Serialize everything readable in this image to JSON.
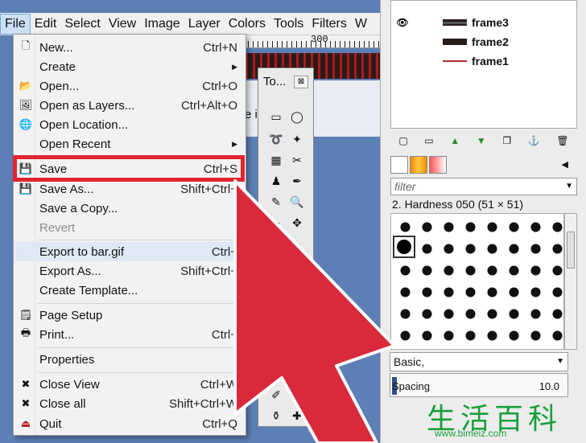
{
  "menubar": {
    "items": [
      {
        "label": "File",
        "active": true
      },
      {
        "label": "Edit"
      },
      {
        "label": "Select"
      },
      {
        "label": "View"
      },
      {
        "label": "Image"
      },
      {
        "label": "Layer"
      },
      {
        "label": "Colors"
      },
      {
        "label": "Tools"
      },
      {
        "label": "Filters"
      },
      {
        "label": "W"
      }
    ]
  },
  "canvas": {
    "ruler_mark": "300",
    "partial_text": "e i",
    "partial_text2": "n"
  },
  "file_menu": {
    "items": [
      {
        "label": "New...",
        "shortcut": "Ctrl+N",
        "icon": "new-file-icon"
      },
      {
        "label": "Create",
        "shortcut": "",
        "submenu": true
      },
      {
        "label": "Open...",
        "shortcut": "Ctrl+O",
        "icon": "open-folder-icon"
      },
      {
        "label": "Open as Layers...",
        "shortcut": "Ctrl+Alt+O",
        "icon": "open-layers-icon"
      },
      {
        "label": "Open Location...",
        "shortcut": "",
        "icon": "globe-icon"
      },
      {
        "label": "Open Recent",
        "shortcut": "",
        "submenu": true
      },
      {
        "label": "Save",
        "shortcut": "Ctrl+S",
        "icon": "save-icon",
        "highlighted": true
      },
      {
        "label": "Save As...",
        "shortcut": "Shift+Ctrl+",
        "icon": "save-as-icon"
      },
      {
        "label": "Save a Copy...",
        "shortcut": ""
      },
      {
        "label": "Revert",
        "shortcut": "",
        "disabled": true
      },
      {
        "label": "Export to bar.gif",
        "shortcut": "Ctrl+"
      },
      {
        "label": "Export As...",
        "shortcut": "Shift+Ctrl+"
      },
      {
        "label": "Create Template...",
        "shortcut": ""
      },
      {
        "label": "Page Setup",
        "shortcut": "",
        "icon": "page-setup-icon"
      },
      {
        "label": "Print...",
        "shortcut": "Ctrl+",
        "icon": "print-icon"
      },
      {
        "label": "Properties",
        "shortcut": ""
      },
      {
        "label": "Close View",
        "shortcut": "Ctrl+W",
        "icon": "close-icon"
      },
      {
        "label": "Close all",
        "shortcut": "Shift+Ctrl+W",
        "icon": "close-icon"
      },
      {
        "label": "Quit",
        "shortcut": "Ctrl+Q",
        "icon": "quit-icon"
      }
    ]
  },
  "toolbox": {
    "title": "To...",
    "close_label": "⊠"
  },
  "layers": {
    "items": [
      {
        "name": "frame3",
        "visible": true
      },
      {
        "name": "frame2",
        "visible": false
      },
      {
        "name": "frame1",
        "visible": false
      }
    ]
  },
  "brushes": {
    "filter_placeholder": "filter",
    "current": "2. Hardness 050 (51 × 51)",
    "preset": "Basic,",
    "spacing_label": "Spacing",
    "spacing_value": "10.0"
  },
  "watermark": {
    "text": "生活百科",
    "url": "www.bimeiz.com"
  },
  "colors": {
    "highlight_border": "#e02430",
    "arrow": "#d9293a"
  }
}
